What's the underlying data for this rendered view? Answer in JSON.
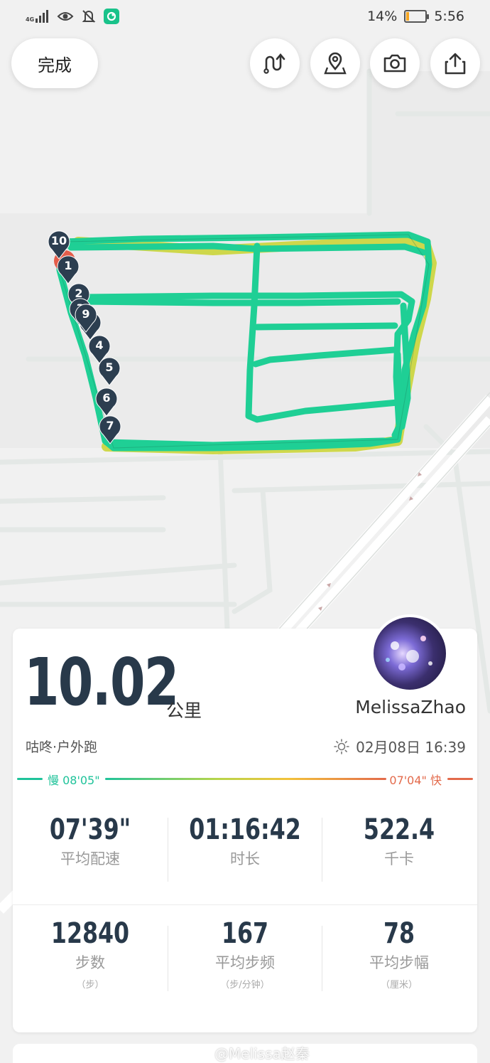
{
  "status_bar": {
    "network": "4G",
    "battery_percent": "14%",
    "battery_level": 0.14,
    "time": "5:56",
    "icons": [
      "signal-icon",
      "eye-icon",
      "bell-off-icon",
      "app-badge-icon"
    ]
  },
  "toolbar": {
    "done_label": "完成",
    "buttons": [
      "route-toggle-icon",
      "location-pin-icon",
      "camera-icon",
      "share-icon"
    ]
  },
  "map": {
    "markers": [
      "10",
      "1",
      "2",
      "3",
      "9",
      "4",
      "5",
      "6",
      "7"
    ]
  },
  "summary": {
    "distance": "10.02",
    "distance_unit": "公里",
    "username": "MelissaZhao",
    "sport_type": "咕咚·户外跑",
    "date_time": "02月08日 16:39",
    "pace_slow_label": "慢 08'05\"",
    "pace_fast_label": "07'04\" 快"
  },
  "stats": {
    "avg_pace": {
      "value": "07'39\"",
      "label": "平均配速"
    },
    "duration": {
      "value": "01:16:42",
      "label": "时长"
    },
    "calories": {
      "value": "522.4",
      "label": "千卡"
    },
    "steps": {
      "value": "12840",
      "label": "步数",
      "unit": "（步）"
    },
    "cadence": {
      "value": "167",
      "label": "平均步频",
      "unit": "（步/分钟）"
    },
    "stride": {
      "value": "78",
      "label": "平均步幅",
      "unit": "（厘米）"
    }
  },
  "watermark": "@Melissa赵秦",
  "colors": {
    "route": "#1fcf95",
    "route_slow": "#c9d32f",
    "accent_slow": "#1fc39a",
    "accent_fast": "#e36a4b",
    "marker": "#2c3e50",
    "start_marker": "#e35d4a"
  }
}
